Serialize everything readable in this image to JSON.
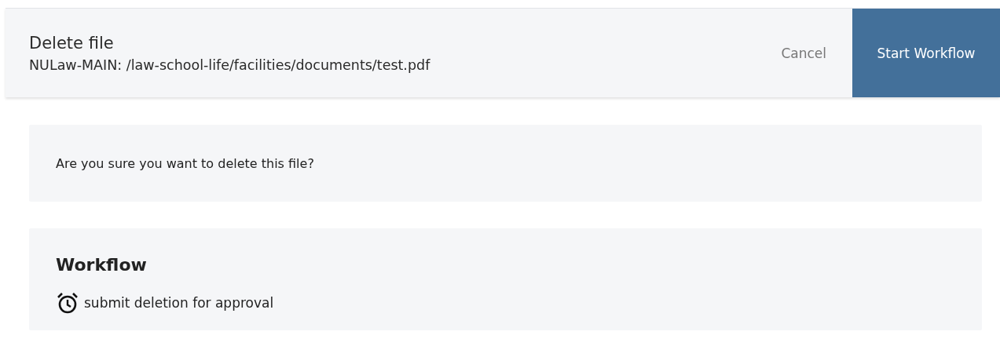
{
  "header": {
    "title": "Delete file",
    "path": "NULaw-MAIN: /law-school-life/facilities/documents/test.pdf",
    "buttons": [
      {
        "label": "Cancel",
        "kind": "secondary"
      },
      {
        "label": "Start Workflow",
        "kind": "primary"
      }
    ]
  },
  "confirmation": {
    "message": "Are you sure you want to delete this file?"
  },
  "workflow": {
    "title": "Workflow",
    "steps": [
      {
        "label": "submit deletion for approval"
      }
    ]
  }
}
